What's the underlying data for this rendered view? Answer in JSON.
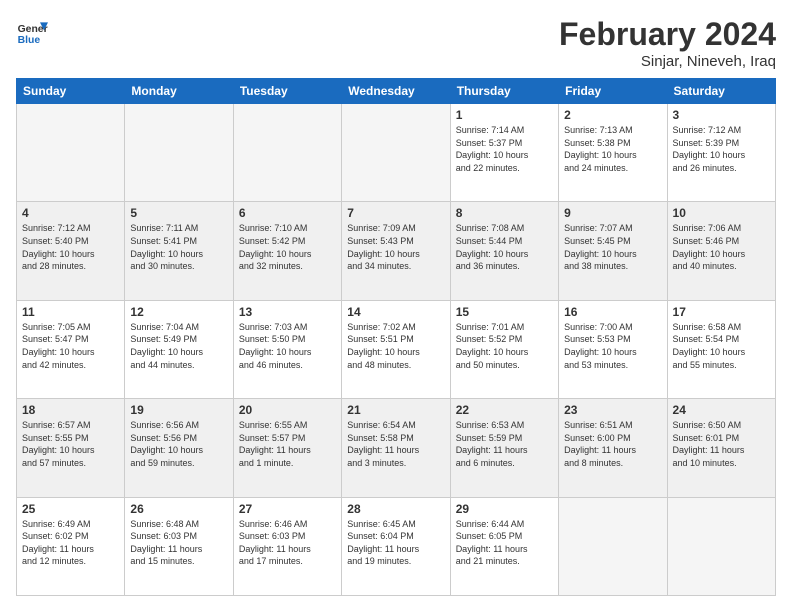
{
  "header": {
    "logo_line1": "General",
    "logo_line2": "Blue",
    "title": "February 2024",
    "subtitle": "Sinjar, Nineveh, Iraq"
  },
  "weekdays": [
    "Sunday",
    "Monday",
    "Tuesday",
    "Wednesday",
    "Thursday",
    "Friday",
    "Saturday"
  ],
  "weeks": [
    [
      {
        "day": "",
        "info": ""
      },
      {
        "day": "",
        "info": ""
      },
      {
        "day": "",
        "info": ""
      },
      {
        "day": "",
        "info": ""
      },
      {
        "day": "1",
        "info": "Sunrise: 7:14 AM\nSunset: 5:37 PM\nDaylight: 10 hours\nand 22 minutes."
      },
      {
        "day": "2",
        "info": "Sunrise: 7:13 AM\nSunset: 5:38 PM\nDaylight: 10 hours\nand 24 minutes."
      },
      {
        "day": "3",
        "info": "Sunrise: 7:12 AM\nSunset: 5:39 PM\nDaylight: 10 hours\nand 26 minutes."
      }
    ],
    [
      {
        "day": "4",
        "info": "Sunrise: 7:12 AM\nSunset: 5:40 PM\nDaylight: 10 hours\nand 28 minutes."
      },
      {
        "day": "5",
        "info": "Sunrise: 7:11 AM\nSunset: 5:41 PM\nDaylight: 10 hours\nand 30 minutes."
      },
      {
        "day": "6",
        "info": "Sunrise: 7:10 AM\nSunset: 5:42 PM\nDaylight: 10 hours\nand 32 minutes."
      },
      {
        "day": "7",
        "info": "Sunrise: 7:09 AM\nSunset: 5:43 PM\nDaylight: 10 hours\nand 34 minutes."
      },
      {
        "day": "8",
        "info": "Sunrise: 7:08 AM\nSunset: 5:44 PM\nDaylight: 10 hours\nand 36 minutes."
      },
      {
        "day": "9",
        "info": "Sunrise: 7:07 AM\nSunset: 5:45 PM\nDaylight: 10 hours\nand 38 minutes."
      },
      {
        "day": "10",
        "info": "Sunrise: 7:06 AM\nSunset: 5:46 PM\nDaylight: 10 hours\nand 40 minutes."
      }
    ],
    [
      {
        "day": "11",
        "info": "Sunrise: 7:05 AM\nSunset: 5:47 PM\nDaylight: 10 hours\nand 42 minutes."
      },
      {
        "day": "12",
        "info": "Sunrise: 7:04 AM\nSunset: 5:49 PM\nDaylight: 10 hours\nand 44 minutes."
      },
      {
        "day": "13",
        "info": "Sunrise: 7:03 AM\nSunset: 5:50 PM\nDaylight: 10 hours\nand 46 minutes."
      },
      {
        "day": "14",
        "info": "Sunrise: 7:02 AM\nSunset: 5:51 PM\nDaylight: 10 hours\nand 48 minutes."
      },
      {
        "day": "15",
        "info": "Sunrise: 7:01 AM\nSunset: 5:52 PM\nDaylight: 10 hours\nand 50 minutes."
      },
      {
        "day": "16",
        "info": "Sunrise: 7:00 AM\nSunset: 5:53 PM\nDaylight: 10 hours\nand 53 minutes."
      },
      {
        "day": "17",
        "info": "Sunrise: 6:58 AM\nSunset: 5:54 PM\nDaylight: 10 hours\nand 55 minutes."
      }
    ],
    [
      {
        "day": "18",
        "info": "Sunrise: 6:57 AM\nSunset: 5:55 PM\nDaylight: 10 hours\nand 57 minutes."
      },
      {
        "day": "19",
        "info": "Sunrise: 6:56 AM\nSunset: 5:56 PM\nDaylight: 10 hours\nand 59 minutes."
      },
      {
        "day": "20",
        "info": "Sunrise: 6:55 AM\nSunset: 5:57 PM\nDaylight: 11 hours\nand 1 minute."
      },
      {
        "day": "21",
        "info": "Sunrise: 6:54 AM\nSunset: 5:58 PM\nDaylight: 11 hours\nand 3 minutes."
      },
      {
        "day": "22",
        "info": "Sunrise: 6:53 AM\nSunset: 5:59 PM\nDaylight: 11 hours\nand 6 minutes."
      },
      {
        "day": "23",
        "info": "Sunrise: 6:51 AM\nSunset: 6:00 PM\nDaylight: 11 hours\nand 8 minutes."
      },
      {
        "day": "24",
        "info": "Sunrise: 6:50 AM\nSunset: 6:01 PM\nDaylight: 11 hours\nand 10 minutes."
      }
    ],
    [
      {
        "day": "25",
        "info": "Sunrise: 6:49 AM\nSunset: 6:02 PM\nDaylight: 11 hours\nand 12 minutes."
      },
      {
        "day": "26",
        "info": "Sunrise: 6:48 AM\nSunset: 6:03 PM\nDaylight: 11 hours\nand 15 minutes."
      },
      {
        "day": "27",
        "info": "Sunrise: 6:46 AM\nSunset: 6:03 PM\nDaylight: 11 hours\nand 17 minutes."
      },
      {
        "day": "28",
        "info": "Sunrise: 6:45 AM\nSunset: 6:04 PM\nDaylight: 11 hours\nand 19 minutes."
      },
      {
        "day": "29",
        "info": "Sunrise: 6:44 AM\nSunset: 6:05 PM\nDaylight: 11 hours\nand 21 minutes."
      },
      {
        "day": "",
        "info": ""
      },
      {
        "day": "",
        "info": ""
      }
    ]
  ]
}
